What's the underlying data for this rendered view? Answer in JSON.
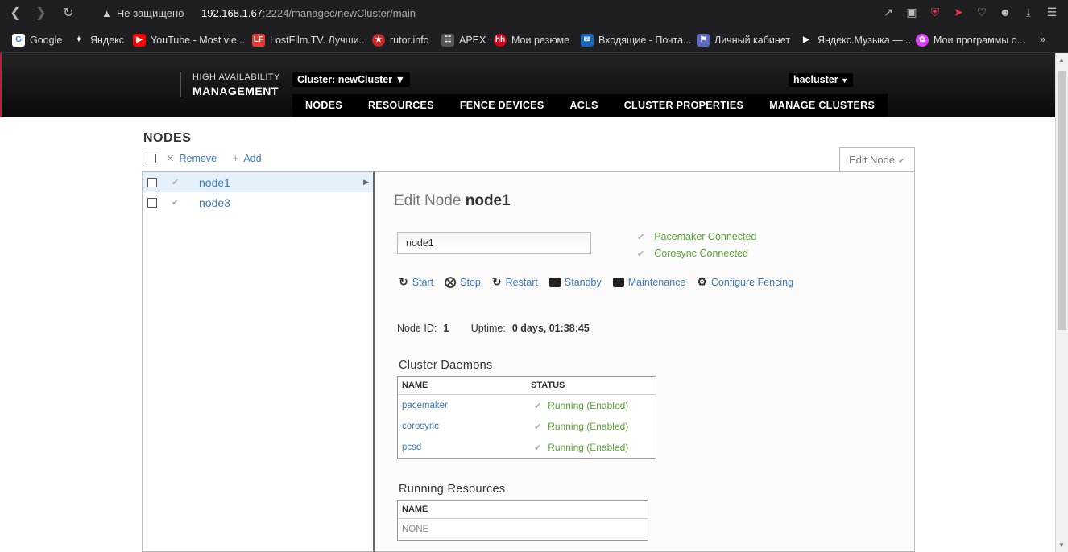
{
  "browser": {
    "security_label": "Не защищено",
    "url_host": "192.168.1.67",
    "url_rest": ":2224/managec/newCluster/main",
    "bookmarks": [
      {
        "label": "Google",
        "icon": "google-icon",
        "color": "#4285f4"
      },
      {
        "label": "Яндекс",
        "icon": "yandex-icon",
        "color": "#ffffff"
      },
      {
        "label": "YouTube - Most vie...",
        "icon": "youtube-icon",
        "color": "#ff0000"
      },
      {
        "label": "LostFilm.TV. Лучши...",
        "icon": "lostfilm-icon",
        "color": "#e53935"
      },
      {
        "label": "rutor.info",
        "icon": "rutor-icon",
        "color": "#c62828"
      },
      {
        "label": "APEX",
        "icon": "apex-icon",
        "color": "#9e9e9e"
      },
      {
        "label": "Мои резюме",
        "icon": "hh-icon",
        "color": "#d6001c"
      },
      {
        "label": "Входящие - Почта...",
        "icon": "mail-icon",
        "color": "#1565c0"
      },
      {
        "label": "Личный кабинет",
        "icon": "cabinet-icon",
        "color": "#5c6bc0"
      },
      {
        "label": "Яндекс.Музыка —...",
        "icon": "music-icon",
        "color": "#ffffff"
      },
      {
        "label": "Мои программы о...",
        "icon": "programs-icon",
        "color": "#e040fb"
      }
    ]
  },
  "header": {
    "brand_line1": "HIGH AVAILABILITY",
    "brand_line2": "MANAGEMENT",
    "cluster_select": "Cluster: newCluster",
    "user": "hacluster",
    "tabs": [
      "NODES",
      "RESOURCES",
      "FENCE DEVICES",
      "ACLS",
      "CLUSTER PROPERTIES",
      "MANAGE CLUSTERS"
    ]
  },
  "page": {
    "title": "NODES",
    "remove_label": "Remove",
    "add_label": "Add",
    "nodes": [
      {
        "name": "node1",
        "selected": true
      },
      {
        "name": "node3",
        "selected": false
      }
    ],
    "edit_tab_label": "Edit Node"
  },
  "edit": {
    "title_prefix": "Edit Node",
    "title_node": "node1",
    "name_value": "node1",
    "status": [
      "Pacemaker Connected",
      "Corosync Connected"
    ],
    "actions": [
      "Start",
      "Stop",
      "Restart",
      "Standby",
      "Maintenance",
      "Configure Fencing"
    ],
    "node_id_label": "Node ID:",
    "node_id": "1",
    "uptime_label": "Uptime:",
    "uptime": "0 days, 01:38:45",
    "daemons_title": "Cluster Daemons",
    "daemons_headers": [
      "NAME",
      "STATUS"
    ],
    "daemons": [
      {
        "name": "pacemaker",
        "status": "Running (Enabled)"
      },
      {
        "name": "corosync",
        "status": "Running (Enabled)"
      },
      {
        "name": "pcsd",
        "status": "Running (Enabled)"
      }
    ],
    "resources_title": "Running Resources",
    "resources_header": "NAME",
    "resources_empty": "NONE"
  }
}
